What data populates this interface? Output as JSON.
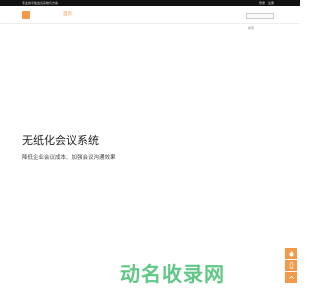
{
  "topbar": {
    "company_text": "专业的平板会议系统与方案",
    "links": [
      "登录",
      "注册"
    ]
  },
  "nav": {
    "home_label": "首页"
  },
  "search": {
    "placeholder": "搜索"
  },
  "hero": {
    "title": "无纸化会议系统",
    "subtitle": "降低企业会议成本、加强会议沟通效果"
  },
  "side_buttons": [
    {
      "icon": "fire-icon"
    },
    {
      "icon": "phone-icon"
    },
    {
      "icon": "arrow-up-icon"
    }
  ],
  "watermark": {
    "text": "动名收录网"
  },
  "colors": {
    "accent": "#f39a4a",
    "topbar_bg": "#111111",
    "watermark": "#4fc27a"
  }
}
